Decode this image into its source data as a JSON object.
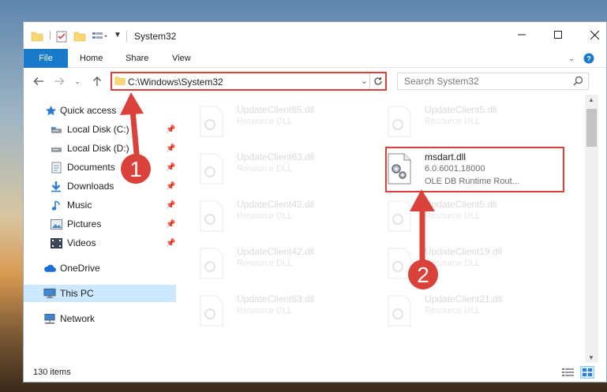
{
  "window": {
    "title": "System32",
    "controls": {
      "minimize": "—",
      "maximize": "☐",
      "close": "✕"
    }
  },
  "ribbon": {
    "tabs": [
      {
        "label": "File",
        "active": true
      },
      {
        "label": "Home"
      },
      {
        "label": "Share"
      },
      {
        "label": "View"
      }
    ]
  },
  "address": {
    "path": "C:\\Windows\\System32",
    "search_placeholder": "Search System32"
  },
  "nav_pane": {
    "items": [
      {
        "label": "Quick access",
        "icon": "star-icon"
      },
      {
        "label": "Local Disk (C:)",
        "icon": "drive-icon",
        "pinned": true
      },
      {
        "label": "Local Disk (D:)",
        "icon": "drive-icon",
        "pinned": true
      },
      {
        "label": "Documents",
        "icon": "documents-icon",
        "pinned": true
      },
      {
        "label": "Downloads",
        "icon": "download-icon",
        "pinned": true
      },
      {
        "label": "Music",
        "icon": "music-icon",
        "pinned": true
      },
      {
        "label": "Pictures",
        "icon": "pictures-icon",
        "pinned": true
      },
      {
        "label": "Videos",
        "icon": "videos-icon",
        "pinned": true
      },
      {
        "label": "OneDrive",
        "icon": "cloud-icon"
      },
      {
        "label": "This PC",
        "icon": "computer-icon",
        "selected": true
      },
      {
        "label": "Network",
        "icon": "network-icon"
      }
    ]
  },
  "files": [
    {
      "name": "UpdateClient65.dll",
      "type": "Resource DLL"
    },
    {
      "name": "UpdateClient5.dll",
      "type": "Resource DLL"
    },
    {
      "name": "UpdateClient63.dll",
      "type": "Resource DLL"
    },
    {
      "name": "msdart.dll",
      "version": "6.0.6001.18000",
      "description": "OLE DB Runtime Rout...",
      "highlighted": true
    },
    {
      "name": "UpdateClient42.dll",
      "type": "Resource DLL"
    },
    {
      "name": "UpdateClient5.dll",
      "type": "Resource DLL"
    },
    {
      "name": "UpdateClient42.dll",
      "type": "Resource DLL"
    },
    {
      "name": "UpdateClient19.dll",
      "type": "Resource DLL"
    },
    {
      "name": "UpdateClient63.dll",
      "type": "Resource DLL"
    },
    {
      "name": "UpdateClient21.dll",
      "type": "Resource DLL"
    }
  ],
  "status": {
    "item_count": "130 items"
  },
  "annotations": {
    "step1": "1",
    "step2": "2",
    "color": "#d9413a"
  },
  "colors": {
    "accent": "#1979ca",
    "selection": "#cce8ff",
    "highlight": "#d9413a"
  }
}
